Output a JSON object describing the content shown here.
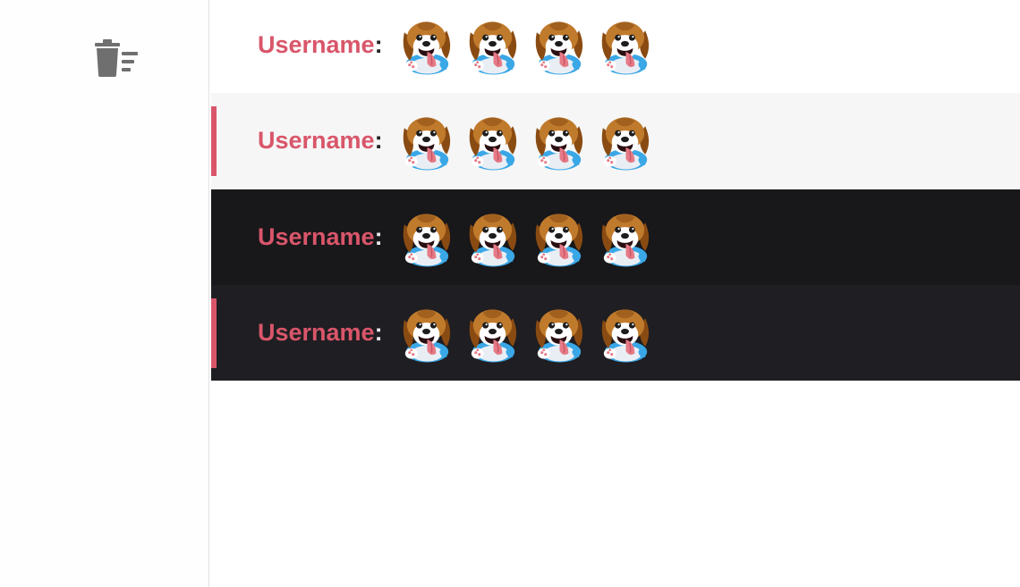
{
  "sidebar": {
    "clear_icon": "trash-list-icon"
  },
  "chat": {
    "messages": [
      {
        "theme": "light",
        "background": "#ffffff",
        "highlighted": false,
        "username": "Username",
        "separator": ":",
        "emote_count": 4,
        "emote_icon": "beagle-emote-icon"
      },
      {
        "theme": "light",
        "background": "#f6f6f6",
        "highlighted": true,
        "username": "Username",
        "separator": ":",
        "emote_count": 4,
        "emote_icon": "beagle-emote-icon"
      },
      {
        "theme": "dark",
        "background": "#18171a",
        "highlighted": false,
        "username": "Username",
        "separator": ":",
        "emote_count": 4,
        "emote_icon": "beagle-emote-icon"
      },
      {
        "theme": "dark",
        "background": "#1f1e22",
        "highlighted": true,
        "username": "Username",
        "separator": ":",
        "emote_count": 4,
        "emote_icon": "beagle-emote-icon"
      }
    ]
  },
  "colors": {
    "accent": "#d9566a",
    "username": "#d9566a"
  }
}
